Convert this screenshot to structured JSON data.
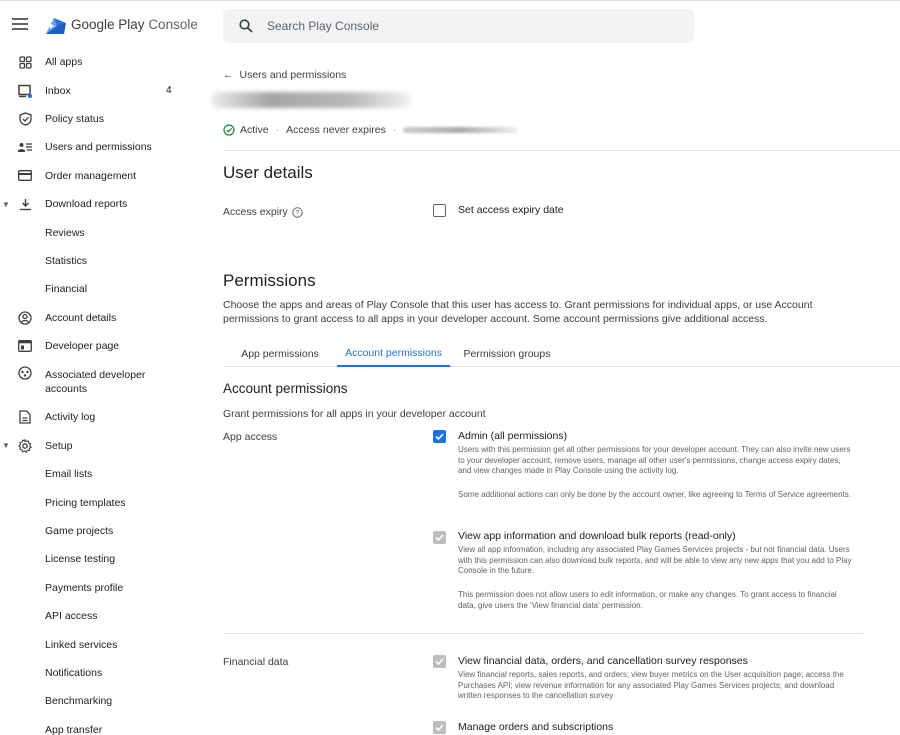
{
  "app": {
    "brand_main": "Google Play",
    "brand_sub": "Console"
  },
  "search": {
    "placeholder": "Search Play Console"
  },
  "sidebar": {
    "items": [
      {
        "label": "All apps"
      },
      {
        "label": "Inbox",
        "badge": "4"
      },
      {
        "label": "Policy status"
      },
      {
        "label": "Users and permissions"
      },
      {
        "label": "Order management"
      },
      {
        "label": "Download reports"
      },
      {
        "label": "Reviews"
      },
      {
        "label": "Statistics"
      },
      {
        "label": "Financial"
      },
      {
        "label": "Account details"
      },
      {
        "label": "Developer page"
      },
      {
        "label": "Associated developer accounts"
      },
      {
        "label": "Activity log"
      },
      {
        "label": "Setup"
      },
      {
        "label": "Email lists"
      },
      {
        "label": "Pricing templates"
      },
      {
        "label": "Game projects"
      },
      {
        "label": "License testing"
      },
      {
        "label": "Payments profile"
      },
      {
        "label": "API access"
      },
      {
        "label": "Linked services"
      },
      {
        "label": "Notifications"
      },
      {
        "label": "Benchmarking"
      },
      {
        "label": "App transfer"
      }
    ]
  },
  "header": {
    "back_label": "Users and permissions",
    "status_active": "Active",
    "status_expiry": "Access never expires"
  },
  "user_details": {
    "title": "User details",
    "access_expiry_label": "Access expiry",
    "set_expiry_label": "Set access expiry date"
  },
  "permissions": {
    "title": "Permissions",
    "description": "Choose the apps and areas of Play Console that this user has access to. Grant permissions for individual apps, or use Account permissions to grant access to all apps in your developer account. Some account permissions give additional access.",
    "tabs": [
      "App permissions",
      "Account permissions",
      "Permission groups"
    ]
  },
  "account_permissions": {
    "title": "Account permissions",
    "subtitle": "Grant permissions for all apps in your developer account",
    "app_access_label": "App access",
    "financial_label": "Financial data",
    "admin_title": "Admin (all permissions)",
    "admin_desc": "Users with this permission get all other permissions for your developer account. They can also invite new users to your developer account, remove users, manage all other user's permissions, change access expiry dates, and view changes made in Play Console using the activity log.",
    "admin_note": "Some additional actions can only be done by the account owner, like agreeing to Terms of Service agreements.",
    "view_title": "View app information and download bulk reports (read-only)",
    "view_desc": "View all app information, including any associated Play Games Services projects - but not financial data. Users with this permission can also download bulk reports, and will be able to view any new apps that you add to Play Console in the future.",
    "view_note": "This permission does not allow users to edit information, or make any changes. To grant access to financial data, give users the 'View financial data' permission.",
    "fin_title": "View financial data, orders, and cancellation survey responses",
    "fin_desc": "View financial reports, sales reports, and orders; view buyer metrics on the User acquisition page; access the Purchases API; view revenue information for any associated Play Games Services projects; and download written responses to the cancellation survey",
    "orders_title": "Manage orders and subscriptions"
  },
  "colors": {
    "accent": "#1a73e8",
    "success": "#188038",
    "disabled": "#bdbdbd"
  }
}
